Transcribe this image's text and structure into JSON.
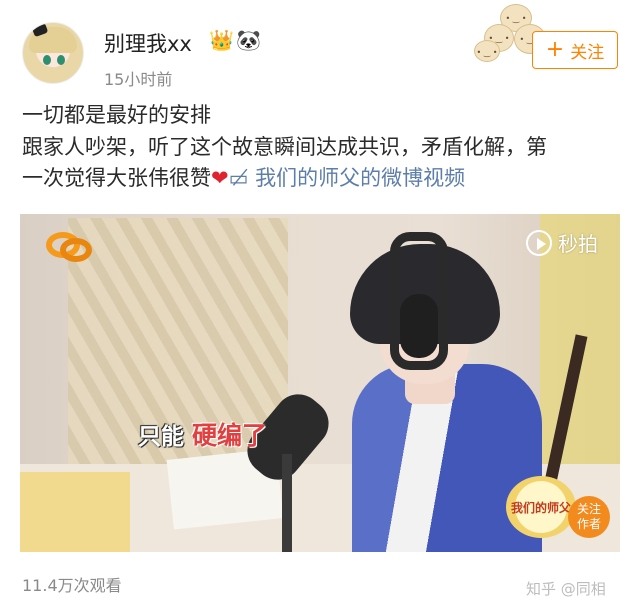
{
  "post": {
    "username": "别理我xx",
    "badge_vip_icon": "crown-vip-icon",
    "badge_panda_icon": "panda-icon",
    "time": "15小时前",
    "follow_label": "关注",
    "text_line1": "一切都是最好的安排",
    "text_line2": "跟家人吵架，听了这个故意瞬间达成共识，矛盾化解，第",
    "text_line3": "一次觉得大张伟很赞",
    "video_link": "我们的师父的微博视频",
    "views": "11.4万次观看"
  },
  "video": {
    "watermark": "秒拍",
    "subtitle_part1": "只能",
    "subtitle_part2": "硬编了",
    "show_badge": "我们的师父",
    "badge_follow": "关注",
    "badge_author": "作者"
  },
  "footer": {
    "brand": "知乎 @同相"
  },
  "colors": {
    "accent": "#ff8200",
    "link": "#5d7ea9",
    "heart": "#e0242f",
    "muted": "#8a8a8a"
  }
}
